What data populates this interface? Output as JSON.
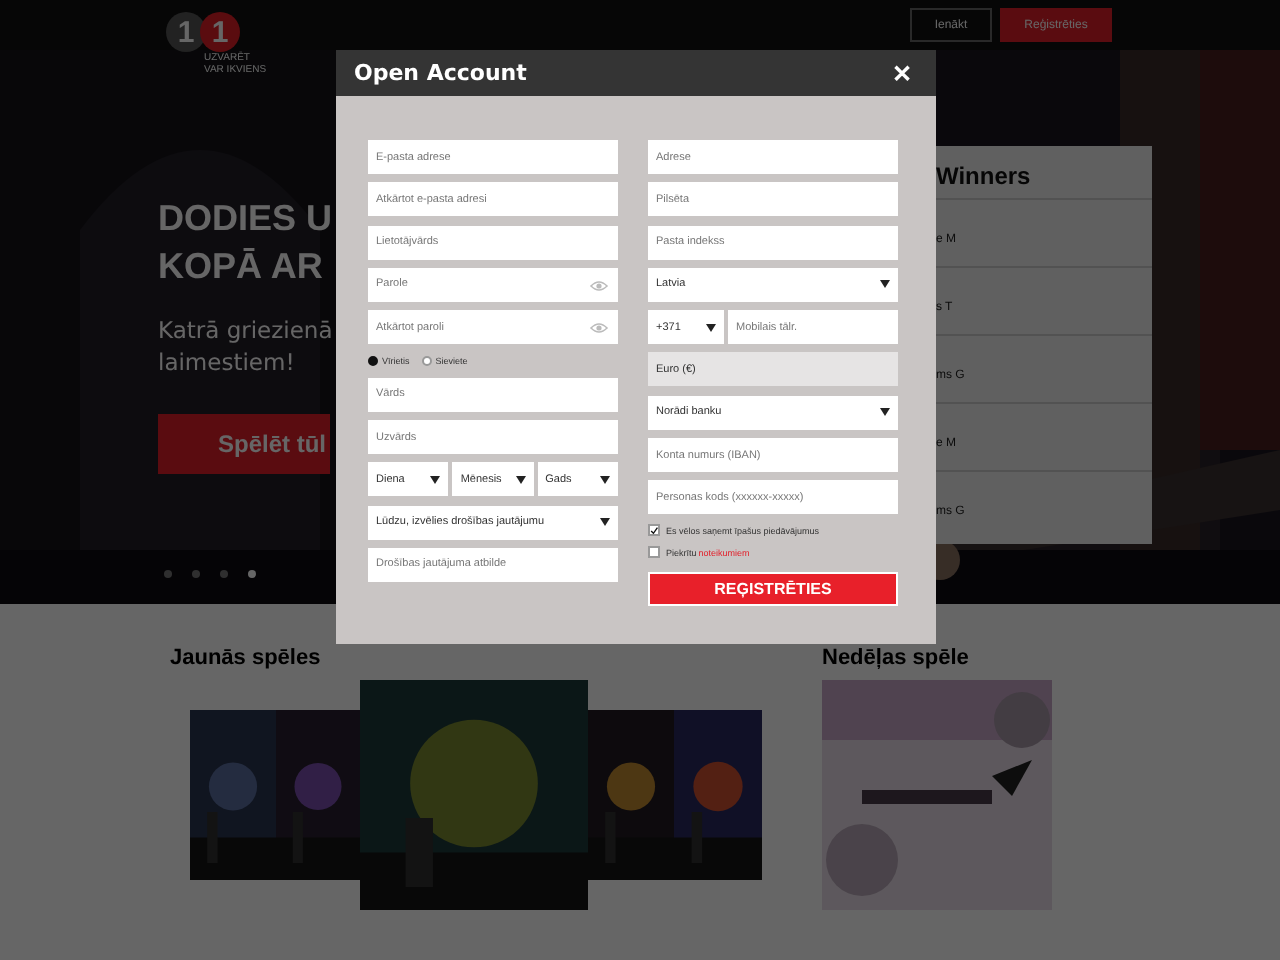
{
  "header": {
    "logo": {
      "digits": [
        "1",
        "1"
      ],
      "tagline": [
        "UZVARĒT",
        "VAR IKVIENS"
      ]
    },
    "buttons": [
      {
        "label": "Ienākt",
        "kind": "outline"
      },
      {
        "label": "Reģistrēties",
        "kind": "primary"
      }
    ]
  },
  "hero": {
    "title_lines": [
      "DODIES U",
      "KOPĀ AR"
    ],
    "text_lines": [
      "Katrā griezienā",
      "laimestiem!"
    ],
    "button": "Spēlēt tūl",
    "dots": [
      {
        "selected": false
      },
      {
        "selected": false
      },
      {
        "selected": false
      },
      {
        "selected": true
      }
    ]
  },
  "winners": {
    "title": "Winners",
    "names": [
      "e M",
      "s T",
      "ms G",
      "e M",
      "ms G"
    ]
  },
  "sections": [
    {
      "title": "Jaunās spēles"
    },
    {
      "title": "Nedēļas spēle"
    }
  ],
  "modal": {
    "title": "Open Account",
    "close": "✕",
    "left_fields": [
      {
        "kind": "text",
        "placeholder": "E-pasta adrese"
      },
      {
        "kind": "text",
        "placeholder": "Atkārtot e-pasta adresi"
      },
      {
        "kind": "text",
        "placeholder": "Lietotājvārds"
      },
      {
        "kind": "password",
        "placeholder": "Parole"
      },
      {
        "kind": "password",
        "placeholder": "Atkārtot paroli"
      },
      {
        "kind": "radio",
        "options": [
          {
            "label": "Vīrietis",
            "selected": true
          },
          {
            "label": "Sieviete",
            "selected": false
          }
        ]
      },
      {
        "kind": "text",
        "placeholder": "Vārds"
      },
      {
        "kind": "text",
        "placeholder": "Uzvārds"
      },
      {
        "kind": "selects",
        "items": [
          "Diena",
          "Mēnesis",
          "Gads"
        ]
      },
      {
        "kind": "select",
        "value": "Lūdzu, izvēlies drošības jautājumu"
      },
      {
        "kind": "text",
        "placeholder": "Drošības jautājuma atbilde"
      }
    ],
    "right_fields": [
      {
        "kind": "text",
        "placeholder": "Adrese"
      },
      {
        "kind": "text",
        "placeholder": "Pilsēta"
      },
      {
        "kind": "text",
        "placeholder": "Pasta indekss"
      },
      {
        "kind": "select",
        "value": "Latvia"
      },
      {
        "kind": "phone",
        "code": "+371",
        "placeholder": "Mobilais tālr."
      },
      {
        "kind": "readonly",
        "value": "Euro (€)"
      },
      {
        "kind": "select",
        "value": "Norādi banku"
      },
      {
        "kind": "text",
        "placeholder": "Konta numurs (IBAN)"
      },
      {
        "kind": "text",
        "placeholder": "Personas kods (xxxxxx-xxxxx)"
      },
      {
        "kind": "checkbox",
        "label": "Es vēlos saņemt īpašus piedāvājumus",
        "checked": true
      },
      {
        "kind": "checkbox",
        "label": "Piekrītu",
        "link": "noteikumiem",
        "checked": false
      }
    ],
    "submit": "REĢISTRĒTIES"
  }
}
